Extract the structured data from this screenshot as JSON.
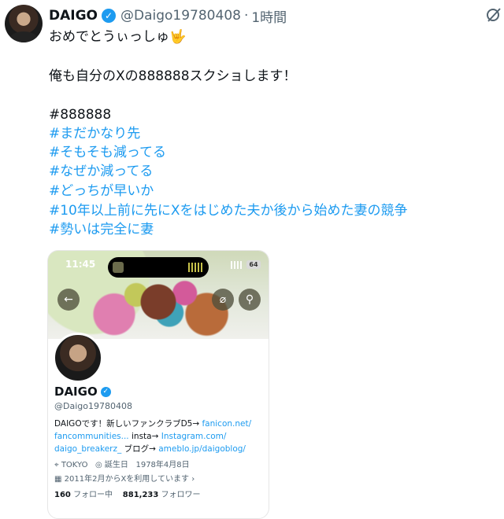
{
  "tweet": {
    "display_name": "DAIGO",
    "handle": "@Daigo19780408",
    "separator": "·",
    "time": "1時間",
    "line1": "おめでとうぃっしゅ🤟",
    "line2": "俺も自分のXの888888スクショします！",
    "number_tag": "#888888",
    "hashtags": [
      "#まだかなり先",
      "#そもそも減ってる",
      "#なぜか減ってる",
      "#どっちが早いか",
      "#10年以上前に先にXをはじめた夫か後から始めた妻の競争",
      "#勢いは完全に妻"
    ]
  },
  "icons": {
    "verified": "verified-badge-icon",
    "grok": "grok-icon"
  },
  "profile_card": {
    "time": "11:45",
    "battery": "64",
    "back_icon": "←",
    "grok_icon": "⌀",
    "search_icon": "⚲",
    "name": "DAIGO",
    "handle": "@Daigo19780408",
    "bio_l1a": "DAIGOです！新しいファンクラブD5→ ",
    "bio_l1b": "fanicon.net/",
    "bio_l2a": "fancommunities...",
    "bio_l2b": " insta→ ",
    "bio_l2c": "Instagram.com/",
    "bio_l3a": "daigo_breakerz_",
    "bio_l3b": " ブログ→ ",
    "bio_l3c": "ameblo.jp/daigoblog/",
    "location": "TOKYO",
    "birth_label": "誕生日",
    "birth": "1978年4月8日",
    "joined": "2011年2月からXを利用しています",
    "following_count": "160",
    "following_label": "フォロー中",
    "followers_count": "881,233",
    "followers_label": "フォロワー"
  },
  "colors": {
    "link": "#1d9bf0",
    "text": "#0f1419",
    "muted": "#536471"
  }
}
